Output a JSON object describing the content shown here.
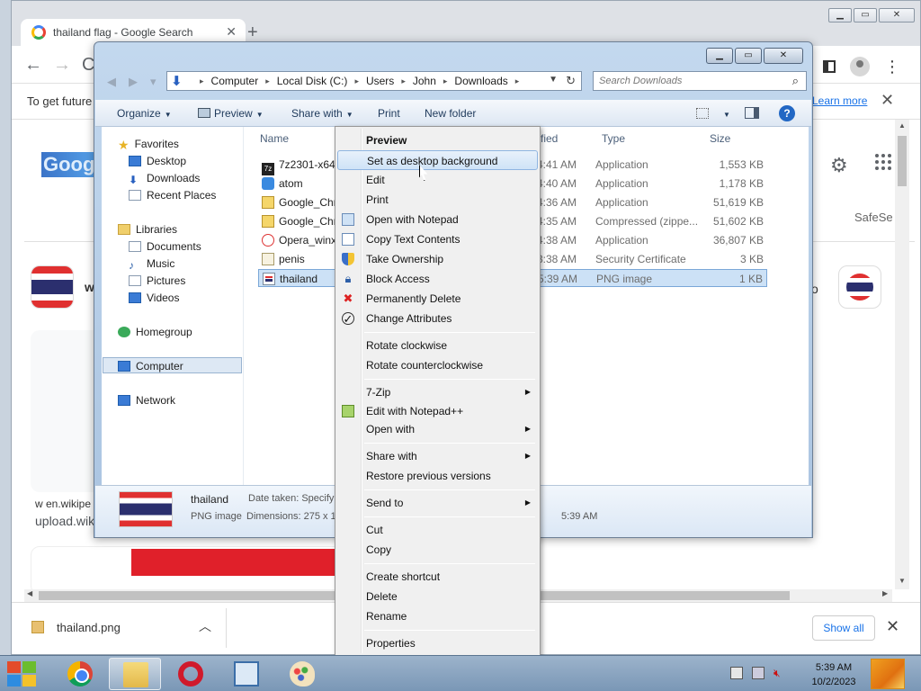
{
  "chrome": {
    "tab_title": "thailand flag - Google Search",
    "info_text": "To get future G",
    "learn_more": "Learn more",
    "right_label": "SafeSe",
    "result_title_left": "w",
    "result_title_right": "o",
    "source_name": "w  en.wikipe",
    "source_url": "upload.wik",
    "download_file": "thailand.png",
    "show_all": "Show all"
  },
  "explorer": {
    "breadcrumbs": [
      "Computer",
      "Local Disk (C:)",
      "Users",
      "John",
      "Downloads"
    ],
    "search_placeholder": "Search Downloads",
    "commands": {
      "organize": "Organize",
      "preview": "Preview",
      "share_with": "Share with",
      "print": "Print",
      "new_folder": "New folder"
    },
    "nav": {
      "favorites": "Favorites",
      "desktop": "Desktop",
      "downloads": "Downloads",
      "recent": "Recent Places",
      "libraries": "Libraries",
      "documents": "Documents",
      "music": "Music",
      "pictures": "Pictures",
      "videos": "Videos",
      "homegroup": "Homegroup",
      "computer": "Computer",
      "network": "Network"
    },
    "columns": {
      "name": "Name",
      "modified": "fied",
      "type": "Type",
      "size": "Size"
    },
    "files": [
      {
        "name": "7z2301-x64",
        "time": "4:41 AM",
        "type": "Application",
        "size": "1,553 KB"
      },
      {
        "name": "atom",
        "time": "4:40 AM",
        "type": "Application",
        "size": "1,178 KB"
      },
      {
        "name": "Google_Chr",
        "time": "4:36 AM",
        "type": "Application",
        "size": "51,619 KB"
      },
      {
        "name": "Google_Chr",
        "time": "4:35 AM",
        "type": "Compressed (zippe...",
        "size": "51,602 KB"
      },
      {
        "name": "Opera_winx",
        "time": "4:38 AM",
        "type": "Application",
        "size": "36,807 KB"
      },
      {
        "name": "penis",
        "time": "3:38 AM",
        "type": "Security Certificate",
        "size": "3 KB"
      },
      {
        "name": "thailand",
        "time": "5:39 AM",
        "type": "PNG image",
        "size": "1 KB"
      }
    ],
    "details": {
      "name": "thailand",
      "date_taken": "Date taken: Specify",
      "type": "PNG image",
      "dimensions": "Dimensions: 275 x 1",
      "time": "5:39 AM"
    }
  },
  "context_menu": {
    "items": [
      "Preview",
      "Set as desktop background",
      "Edit",
      "Print",
      "Open with Notepad",
      "Copy Text Contents",
      "Take Ownership",
      "Block Access",
      "Permanently Delete",
      "Change Attributes",
      "Rotate clockwise",
      "Rotate counterclockwise",
      "7-Zip",
      "Edit with Notepad++",
      "Open with",
      "Share with",
      "Restore previous versions",
      "Send to",
      "Cut",
      "Copy",
      "Create shortcut",
      "Delete",
      "Rename",
      "Properties"
    ]
  },
  "taskbar": {
    "time": "5:39 AM",
    "date": "10/2/2023"
  },
  "colors": {
    "menu_highlight": "#cfe3f7",
    "selection": "#cce1f6",
    "flag_red": "#e03030",
    "flag_blue": "#2b2f6e"
  }
}
